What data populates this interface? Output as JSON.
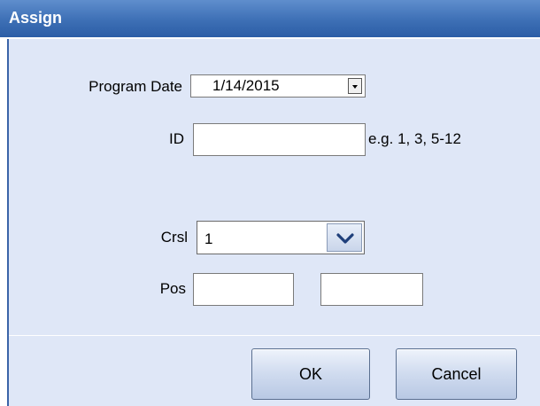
{
  "window": {
    "title": "Assign"
  },
  "form": {
    "program_date_label": "Program Date",
    "program_date_value": "1/14/2015",
    "id_label": "ID",
    "id_value": "",
    "id_hint": "e.g. 1, 3, 5-12",
    "crsl_label": "Crsl",
    "crsl_value": "1",
    "pos_label": "Pos",
    "pos_value_1": "",
    "pos_value_2": ""
  },
  "buttons": {
    "ok": "OK",
    "cancel": "Cancel"
  },
  "icons": {
    "date_dropdown": "triangle-down-icon",
    "crsl_dropdown": "chevron-down-icon"
  },
  "colors": {
    "titlebar": "#3d6fb5",
    "dialog_background": "#dfe7f7",
    "border_accent": "#3a64a8"
  }
}
